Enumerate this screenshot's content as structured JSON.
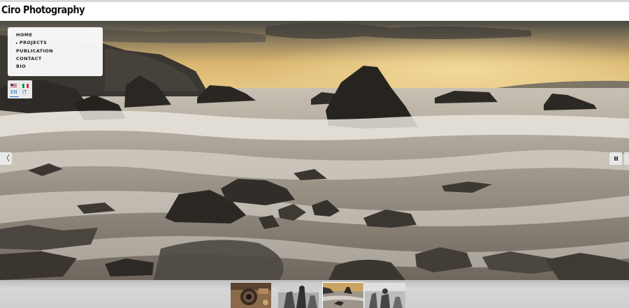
{
  "site": {
    "title": "Ciro Photography"
  },
  "nav": {
    "items": [
      {
        "label": "HOME",
        "expandable": false
      },
      {
        "label": "PROJECTS",
        "expandable": true
      },
      {
        "label": "PUBLICATION",
        "expandable": false
      },
      {
        "label": "CONTACT",
        "expandable": false
      },
      {
        "label": "BIO",
        "expandable": false
      }
    ]
  },
  "language": {
    "options": [
      {
        "code": "EN",
        "flag": "us-flag-icon",
        "selected": true
      },
      {
        "code": "IT",
        "flag": "italy-flag-icon",
        "selected": false
      }
    ]
  },
  "slideshow": {
    "prev_icon": "chevron-left-icon",
    "prev_glyph": "〈",
    "pause_icon": "pause-icon",
    "thumbnails": [
      {
        "subject": "camera",
        "active": false
      },
      {
        "subject": "bw-figures",
        "active": false
      },
      {
        "subject": "seascape",
        "active": true
      },
      {
        "subject": "bw-scene",
        "active": false
      }
    ]
  },
  "colors": {
    "link": "#2e6bd1",
    "panel": "#ffffff",
    "thumb_strip": "#cfcfcf"
  }
}
